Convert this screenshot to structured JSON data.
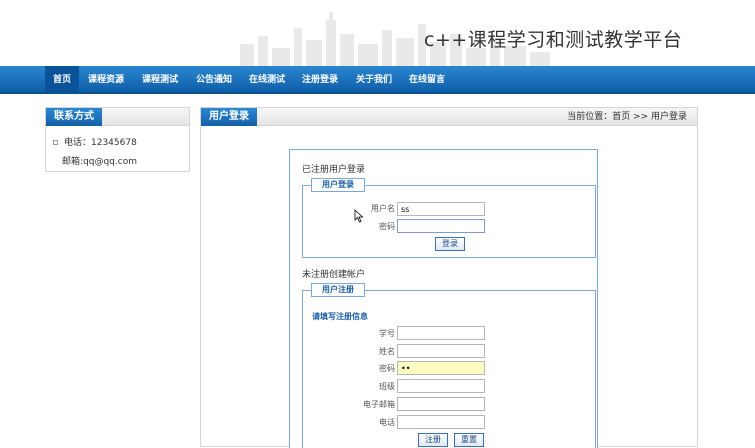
{
  "header": {
    "site_title": "c++课程学习和测试教学平台"
  },
  "nav": {
    "items": [
      {
        "label": "首页",
        "active": true
      },
      {
        "label": "课程资源",
        "active": false
      },
      {
        "label": "课程测试",
        "active": false
      },
      {
        "label": "公告通知",
        "active": false
      },
      {
        "label": "在线测试",
        "active": false
      },
      {
        "label": "注册登录",
        "active": false
      },
      {
        "label": "关于我们",
        "active": false
      },
      {
        "label": "在线留言",
        "active": false
      }
    ]
  },
  "sidebar": {
    "title": "联系方式",
    "phone": "电话：12345678",
    "email": "邮箱:qq@qq.com"
  },
  "main": {
    "tab_title": "用户登录",
    "breadcrumb": "当前位置：首页 >> 用户登录",
    "login": {
      "section_title": "已注册用户登录",
      "legend": "用户登录",
      "username_label": "用户名",
      "username_value": "ss",
      "password_label": "密码",
      "password_value": "",
      "submit_label": "登录"
    },
    "register": {
      "section_title": "未注册创建帐户",
      "legend": "用户注册",
      "hint": "请填写注册信息",
      "fields": [
        {
          "label": "学号",
          "value": ""
        },
        {
          "label": "姓名",
          "value": ""
        },
        {
          "label": "密码",
          "value": "••"
        },
        {
          "label": "班级",
          "value": ""
        },
        {
          "label": "电子邮箱",
          "value": ""
        },
        {
          "label": "电话",
          "value": ""
        }
      ],
      "submit_label": "注册",
      "reset_label": "重置"
    }
  },
  "colors": {
    "nav_blue": "#1a6fbb",
    "tab_blue": "#1f74c2",
    "border_blue": "#7fa8d6",
    "autofill_yellow": "#fbfbc0"
  }
}
